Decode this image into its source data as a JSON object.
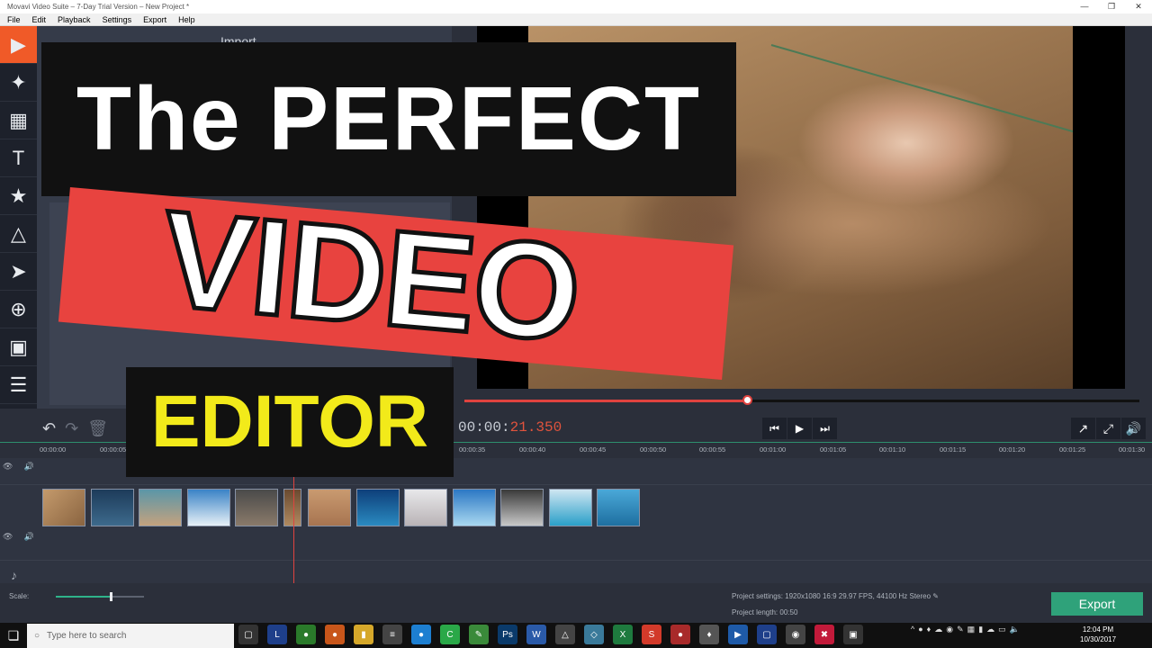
{
  "window": {
    "title": "Movavi Video Suite – 7-Day Trial Version – New Project *"
  },
  "menu": [
    "File",
    "Edit",
    "Playback",
    "Settings",
    "Export",
    "Help"
  ],
  "import_panel": {
    "title": "Import"
  },
  "overlay": {
    "line1": "The PERFECT",
    "line2": "VIDEO",
    "line3": "EDITOR"
  },
  "player": {
    "progress_fraction": 0.42,
    "timecode_main": "00:00:",
    "timecode_accent": "21.350"
  },
  "ruler": [
    "00:00:00",
    "00:00:05",
    "00:00:35",
    "00:00:40",
    "00:00:45",
    "00:00:50",
    "00:00:55",
    "00:01:00",
    "00:01:05",
    "00:01:10",
    "00:01:15",
    "00:01:20",
    "00:01:25",
    "00:01:30"
  ],
  "scale": {
    "label": "Scale:",
    "level_fraction": 0.62
  },
  "project": {
    "settings_label": "Project settings:",
    "settings_value": "1920x1080 16:9 29.97 FPS, 44100 Hz Stereo",
    "length_label": "Project length:",
    "length_value": "00:50"
  },
  "export_label": "Export",
  "taskbar": {
    "search_placeholder": "Type here to search",
    "time": "12:04 PM",
    "date": "10/30/2017"
  },
  "colors": {
    "accent": "#f05a28",
    "scrubber": "#e0433f",
    "export": "#2fa27a",
    "timeline_accent": "#2d8f6d"
  }
}
